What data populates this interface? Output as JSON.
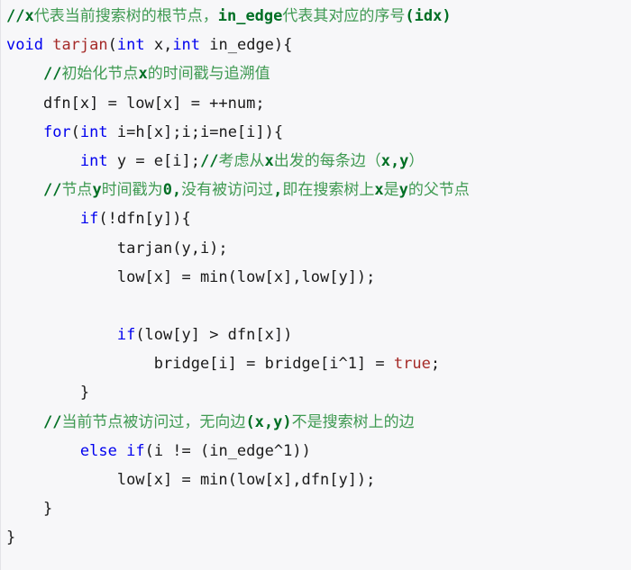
{
  "document": {
    "kind": "source-code-snippet",
    "language": "C++",
    "title": "tarjan bridge-finding function",
    "background_color": "#f7f7f9",
    "colors": {
      "keyword": "#0000ef",
      "function_name": "#a52a28",
      "literal": "#a52a28",
      "comment_cjk": "#3f9a52",
      "comment_ascii": "#006f24",
      "plain_text": "#1a1a1a",
      "background": "#f7f7f9",
      "border": "#e3e3e8"
    }
  },
  "code": {
    "lines": [
      {
        "n": 1,
        "indent": 0,
        "tokens": [
          {
            "t": "//",
            "c": "cmt-ascii"
          },
          {
            "t": "x",
            "c": "cmt-ascii"
          },
          {
            "t": "代表当前搜索树的根节点，",
            "c": "cmt"
          },
          {
            "t": "in_edge",
            "c": "cmt-ascii"
          },
          {
            "t": "代表其对应的序号",
            "c": "cmt"
          },
          {
            "t": "(idx)",
            "c": "cmt-ascii"
          }
        ]
      },
      {
        "n": 2,
        "indent": 0,
        "tokens": [
          {
            "t": "void",
            "c": "kw"
          },
          {
            "t": " ",
            "c": "plain"
          },
          {
            "t": "tarjan",
            "c": "fn"
          },
          {
            "t": "(",
            "c": "plain"
          },
          {
            "t": "int",
            "c": "kw"
          },
          {
            "t": " x,",
            "c": "plain"
          },
          {
            "t": "int",
            "c": "kw"
          },
          {
            "t": " in_edge){",
            "c": "plain"
          }
        ]
      },
      {
        "n": 3,
        "indent": 1,
        "tokens": [
          {
            "t": "//",
            "c": "cmt-ascii"
          },
          {
            "t": "初始化节点",
            "c": "cmt"
          },
          {
            "t": "x",
            "c": "cmt-ascii"
          },
          {
            "t": "的时间戳与追溯值",
            "c": "cmt"
          }
        ]
      },
      {
        "n": 4,
        "indent": 1,
        "tokens": [
          {
            "t": "dfn[x] = low[x] = ++num;",
            "c": "plain"
          }
        ]
      },
      {
        "n": 5,
        "indent": 1,
        "tokens": [
          {
            "t": "for",
            "c": "kw"
          },
          {
            "t": "(",
            "c": "plain"
          },
          {
            "t": "int",
            "c": "kw"
          },
          {
            "t": " i=h[x];i;i=ne[i]){",
            "c": "plain"
          }
        ]
      },
      {
        "n": 6,
        "indent": 2,
        "tokens": [
          {
            "t": "int",
            "c": "kw"
          },
          {
            "t": " y = e[i];",
            "c": "plain"
          },
          {
            "t": "//",
            "c": "cmt-ascii"
          },
          {
            "t": "考虑从",
            "c": "cmt"
          },
          {
            "t": "x",
            "c": "cmt-ascii"
          },
          {
            "t": "出发的每条边（",
            "c": "cmt"
          },
          {
            "t": "x,y",
            "c": "cmt-ascii"
          },
          {
            "t": "）",
            "c": "cmt"
          }
        ]
      },
      {
        "n": 7,
        "indent": 1,
        "tokens": [
          {
            "t": "//",
            "c": "cmt-ascii"
          },
          {
            "t": "节点",
            "c": "cmt"
          },
          {
            "t": "y",
            "c": "cmt-ascii"
          },
          {
            "t": "时间戳为",
            "c": "cmt"
          },
          {
            "t": "0,",
            "c": "cmt-ascii"
          },
          {
            "t": "没有被访问过",
            "c": "cmt"
          },
          {
            "t": ",",
            "c": "cmt-ascii"
          },
          {
            "t": "即在搜索树上",
            "c": "cmt"
          },
          {
            "t": "x",
            "c": "cmt-ascii"
          },
          {
            "t": "是",
            "c": "cmt"
          },
          {
            "t": "y",
            "c": "cmt-ascii"
          },
          {
            "t": "的父节点",
            "c": "cmt"
          }
        ]
      },
      {
        "n": 8,
        "indent": 2,
        "tokens": [
          {
            "t": "if",
            "c": "kw"
          },
          {
            "t": "(!dfn[y]){",
            "c": "plain"
          }
        ]
      },
      {
        "n": 9,
        "indent": 3,
        "tokens": [
          {
            "t": "tarjan(y,i);",
            "c": "plain"
          }
        ]
      },
      {
        "n": 10,
        "indent": 3,
        "tokens": [
          {
            "t": "low[x] = min(low[x],low[y]);",
            "c": "plain"
          }
        ]
      },
      {
        "n": 11,
        "indent": 0,
        "blank": true,
        "tokens": []
      },
      {
        "n": 12,
        "indent": 3,
        "tokens": [
          {
            "t": "if",
            "c": "kw"
          },
          {
            "t": "(low[y] > dfn[x])",
            "c": "plain"
          }
        ]
      },
      {
        "n": 13,
        "indent": 4,
        "tokens": [
          {
            "t": "bridge[i] = bridge[i^1] = ",
            "c": "plain"
          },
          {
            "t": "true",
            "c": "lit"
          },
          {
            "t": ";",
            "c": "plain"
          }
        ]
      },
      {
        "n": 14,
        "indent": 2,
        "tokens": [
          {
            "t": "}",
            "c": "plain"
          }
        ]
      },
      {
        "n": 15,
        "indent": 1,
        "tokens": [
          {
            "t": "//",
            "c": "cmt-ascii"
          },
          {
            "t": "当前节点被访问过，无向边",
            "c": "cmt"
          },
          {
            "t": "(x,y)",
            "c": "cmt-ascii"
          },
          {
            "t": "不是搜索树上的边",
            "c": "cmt"
          }
        ]
      },
      {
        "n": 16,
        "indent": 2,
        "tokens": [
          {
            "t": "else",
            "c": "kw"
          },
          {
            "t": " ",
            "c": "plain"
          },
          {
            "t": "if",
            "c": "kw"
          },
          {
            "t": "(i != (in_edge^1))",
            "c": "plain"
          }
        ]
      },
      {
        "n": 17,
        "indent": 3,
        "tokens": [
          {
            "t": "low[x] = min(low[x],dfn[y]);",
            "c": "plain"
          }
        ]
      },
      {
        "n": 18,
        "indent": 1,
        "tokens": [
          {
            "t": "}",
            "c": "plain"
          }
        ]
      },
      {
        "n": 19,
        "indent": 0,
        "tokens": [
          {
            "t": "}",
            "c": "plain"
          }
        ]
      }
    ]
  }
}
